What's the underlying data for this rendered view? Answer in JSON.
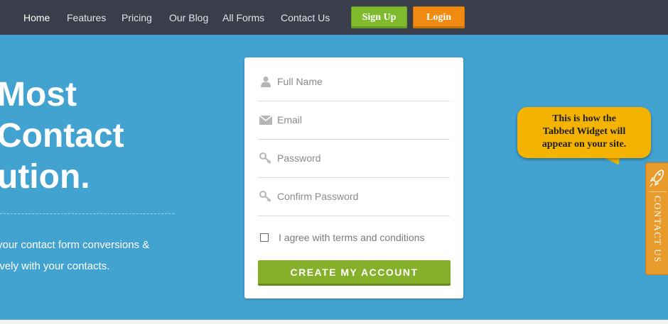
{
  "nav": {
    "links": [
      "Home",
      "Features",
      "Pricing",
      "Our Blog",
      "All Forms",
      "Contact Us"
    ],
    "signup_label": "Sign Up",
    "login_label": "Login"
  },
  "hero": {
    "title_lines": [
      "Most",
      "Contact",
      "ution."
    ],
    "desc_lines": [
      "your contact form conversions &",
      "ively with your contacts."
    ]
  },
  "form": {
    "full_name_placeholder": "Full Name",
    "email_placeholder": "Email",
    "password_placeholder": "Password",
    "confirm_password_placeholder": "Confirm Password",
    "terms_label": "I agree with terms and conditions",
    "terms_checked": false,
    "submit_label": "CREATE MY ACCOUNT"
  },
  "callout": {
    "lines": [
      "This is how the",
      "Tabbed Widget will",
      "appear on your site."
    ]
  },
  "side_tab": {
    "label": "CONTACT US",
    "icon": "rocket-icon"
  },
  "colors": {
    "background": "#42a2d0",
    "topbar": "#3a3e4a",
    "signup": "#7dbb2d",
    "login": "#f08a10",
    "submit": "#84b02a",
    "callout": "#f4b300",
    "side_tab": "#e89a2b"
  }
}
